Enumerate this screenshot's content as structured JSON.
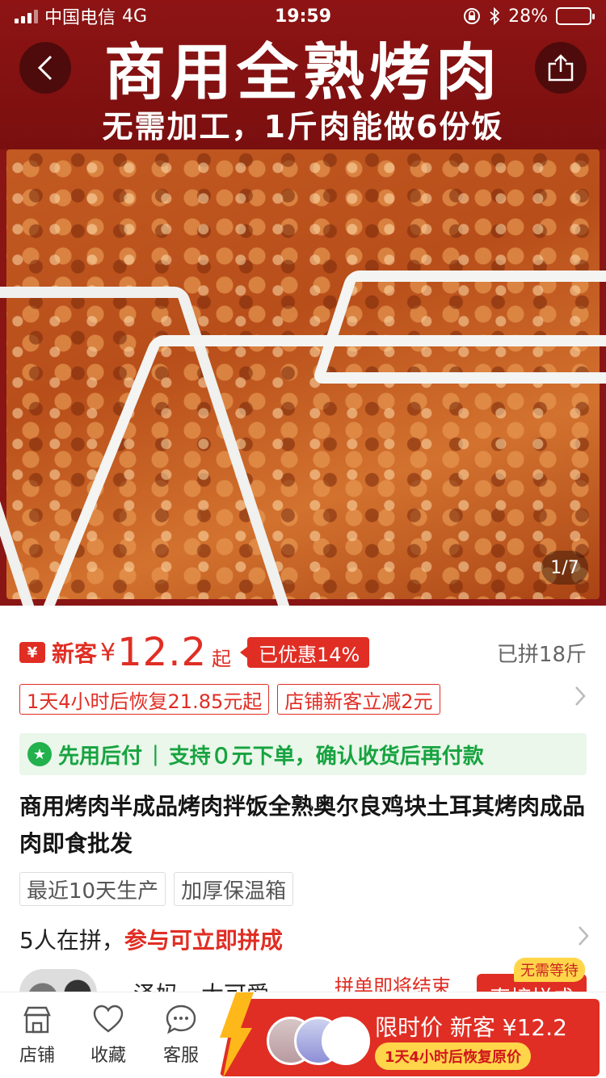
{
  "status": {
    "carrier": "中国电信",
    "network": "4G",
    "time": "19:59",
    "battery": "28%"
  },
  "hero": {
    "title": "商用全熟烤肉",
    "subtitle": "无需加工，1斤肉能做6份饭",
    "pager": "1/7"
  },
  "price": {
    "yen_icon": "¥",
    "new_customer_label": "新客",
    "currency": "¥",
    "amount": "12.2",
    "suffix": "起",
    "discount_badge": "已优惠14%",
    "sold": "已拼18斤"
  },
  "coupons": [
    "1天4小时后恢复21.85元起",
    "店铺新客立减2元"
  ],
  "pay_later": {
    "label": "先用后付",
    "separator": "|",
    "description": "支持０元下单，确认收货后再付款"
  },
  "product_title": "商用烤肉半成品烤肉拌饭全熟奥尔良鸡块土耳其烤肉成品肉即食批发",
  "tags": [
    "最近10天生产",
    "加厚保温箱"
  ],
  "group": {
    "count_text": "5人在拼，",
    "highlight": "参与可立即拼成",
    "row_name": "泽妈、大可爱",
    "row_ending": "拼单即将结束",
    "row_join": "直接拼成",
    "no_wait": "无需等待"
  },
  "bottom_nav": {
    "shop": "店铺",
    "favorite": "收藏",
    "service": "客服"
  },
  "buy": {
    "main": "限时价 新客 ¥12.2",
    "sub": "1天4小时后恢复原价"
  },
  "colors": {
    "accent": "#e02e24",
    "banner": "#8e1414",
    "pay_later_green": "#17a340",
    "badge_yellow": "#ffd54a"
  }
}
